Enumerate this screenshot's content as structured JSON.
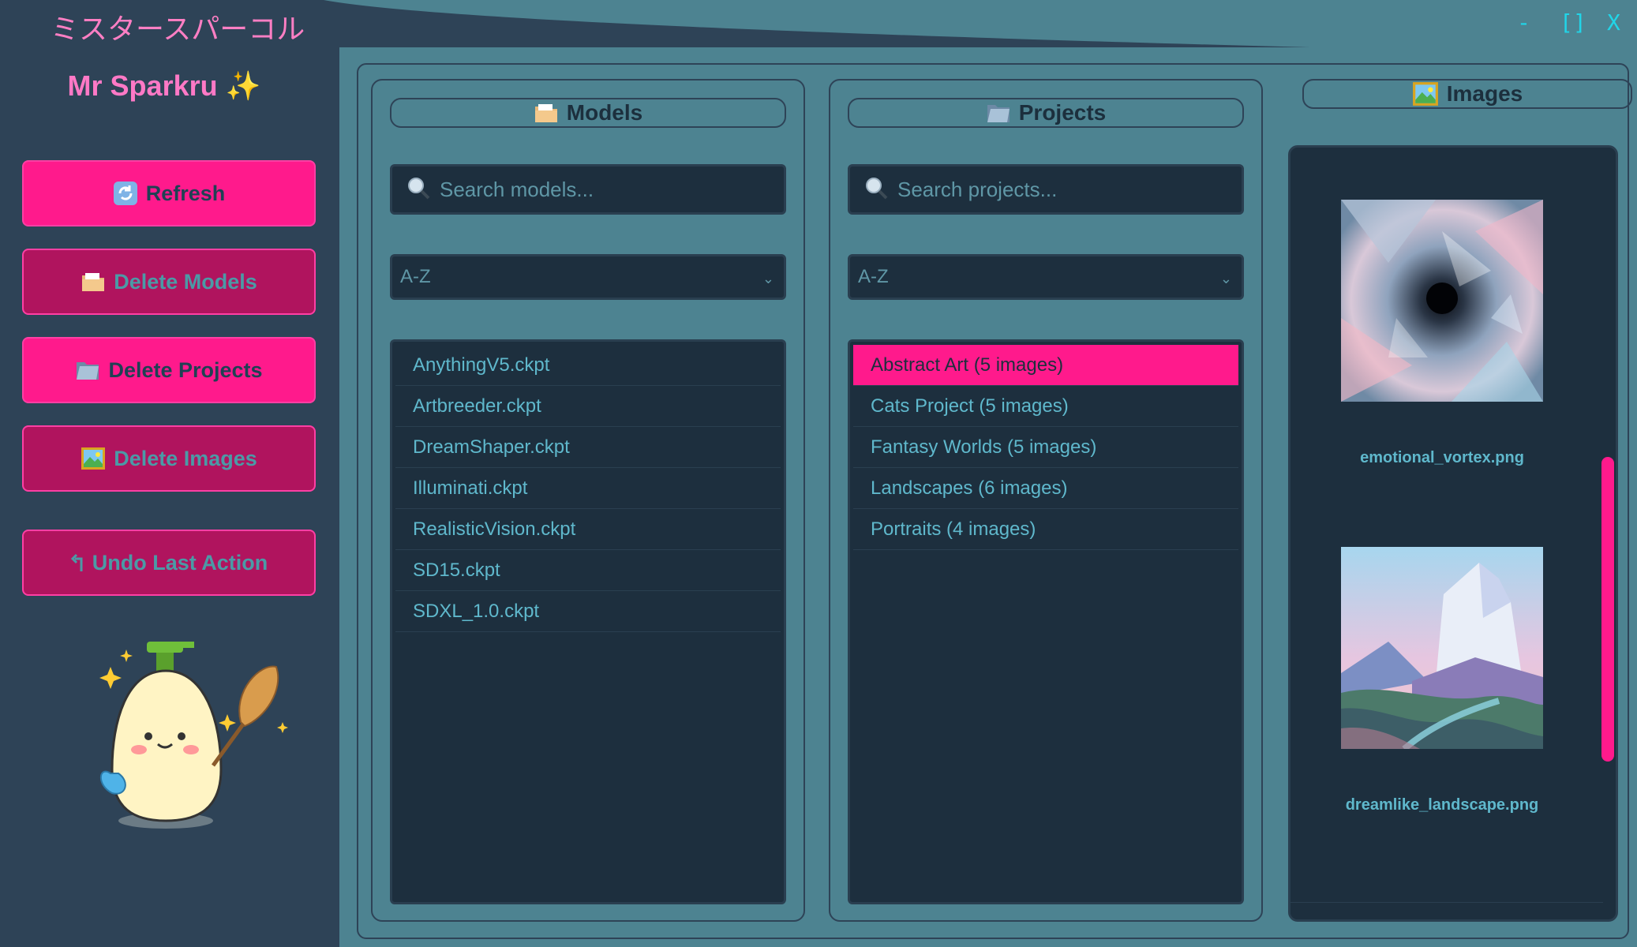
{
  "window": {
    "title": "ミスタースパーコル",
    "minimize_label": "-",
    "maximize_label": "[]",
    "close_label": "X"
  },
  "sidebar": {
    "brand": "Mr Sparkru ✨",
    "buttons": [
      {
        "label": "Refresh",
        "icon": "refresh-icon",
        "state": "active"
      },
      {
        "label": "Delete Models",
        "icon": "folder-icon",
        "state": "disabled"
      },
      {
        "label": "Delete Projects",
        "icon": "folder-icon",
        "state": "active"
      },
      {
        "label": "Delete Images",
        "icon": "picture-icon",
        "state": "disabled"
      },
      {
        "label": "Undo Last Action",
        "icon": "undo-icon",
        "state": "disabled"
      }
    ],
    "mascot": "cleaning-mascot"
  },
  "models": {
    "title": "Models",
    "search_placeholder": "Search models...",
    "sort_value": "A-Z",
    "items": [
      "AnythingV5.ckpt",
      "Artbreeder.ckpt",
      "DreamShaper.ckpt",
      "Illuminati.ckpt",
      "RealisticVision.ckpt",
      "SD15.ckpt",
      "SDXL_1.0.ckpt"
    ]
  },
  "projects": {
    "title": "Projects",
    "search_placeholder": "Search projects...",
    "sort_value": "A-Z",
    "items": [
      "Abstract Art (5 images)",
      "Cats Project (5 images)",
      "Fantasy Worlds (5 images)",
      "Landscapes (6 images)",
      "Portraits (4 images)"
    ],
    "selected_index": 0
  },
  "images": {
    "title": "Images",
    "items": [
      {
        "filename": "emotional_vortex.png"
      },
      {
        "filename": "dreamlike_landscape.png"
      }
    ]
  },
  "colors": {
    "accent": "#ff1a8c",
    "text_teal": "#5fb8cc",
    "panel_bg": "#4d8391",
    "dark_bg": "#1d2f3e",
    "sidebar_bg": "#2e4357"
  }
}
